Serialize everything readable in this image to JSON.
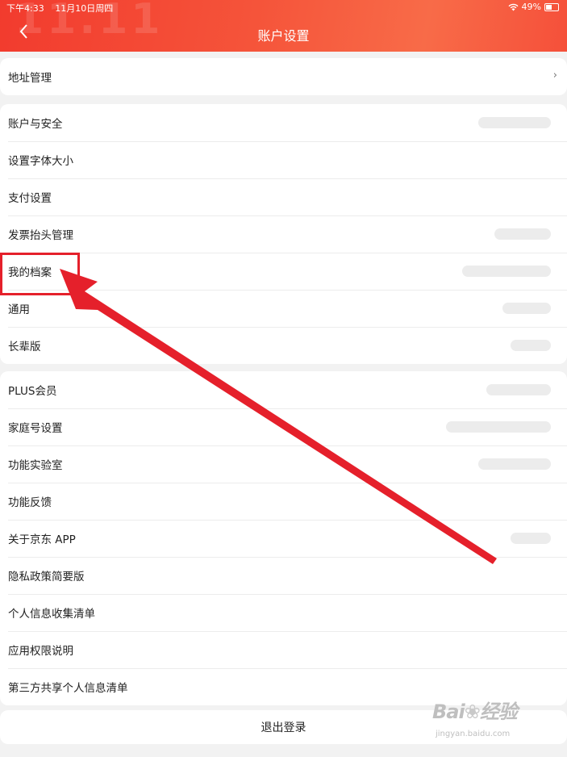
{
  "status_bar": {
    "time": "下午4:33",
    "date": "11月10日周四",
    "battery": "49%"
  },
  "header": {
    "decoration": "11.11",
    "title": "账户设置"
  },
  "sections": [
    {
      "items": [
        {
          "label": "地址管理"
        }
      ]
    },
    {
      "items": [
        {
          "label": "账户与安全"
        },
        {
          "label": "设置字体大小"
        },
        {
          "label": "支付设置"
        },
        {
          "label": "发票抬头管理"
        },
        {
          "label": "我的档案"
        },
        {
          "label": "通用"
        },
        {
          "label": "长辈版"
        }
      ]
    },
    {
      "items": [
        {
          "label": "PLUS会员"
        },
        {
          "label": "家庭号设置"
        },
        {
          "label": "功能实验室"
        },
        {
          "label": "功能反馈"
        },
        {
          "label": "关于京东 APP"
        },
        {
          "label": "隐私政策简要版"
        },
        {
          "label": "个人信息收集清单"
        },
        {
          "label": "应用权限说明"
        },
        {
          "label": "第三方共享个人信息清单"
        }
      ]
    }
  ],
  "logout_label": "退出登录",
  "annotation": {
    "color": "#e5202b"
  },
  "watermark": {
    "logo": "Bai du 经验",
    "site": "jingyan.baidu.com"
  }
}
